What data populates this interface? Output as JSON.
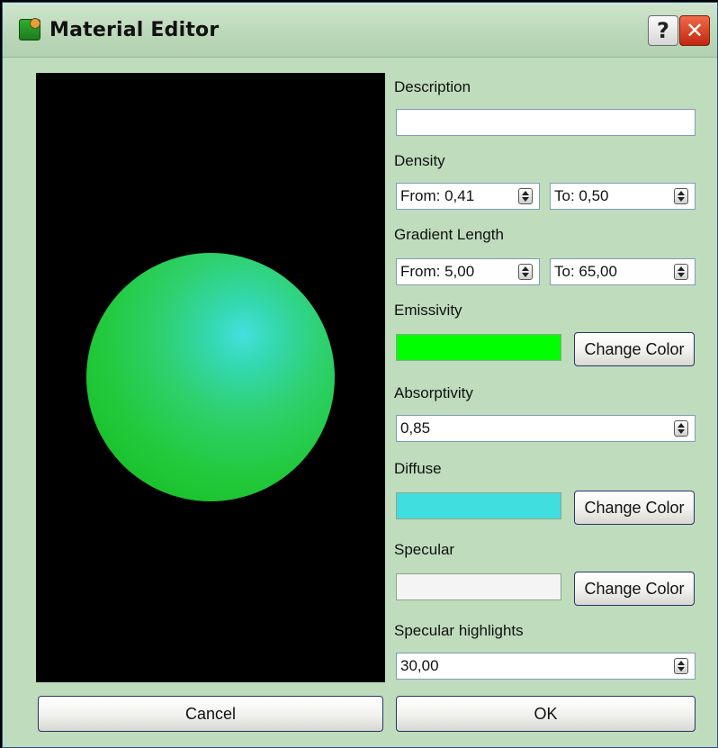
{
  "window": {
    "title": "Material Editor",
    "help_label": "?",
    "close_label": "✕"
  },
  "preview": {
    "diffuse_color": "#40dede",
    "emissive_color": "#00ff00",
    "icon": "material-sphere-preview"
  },
  "description": {
    "label": "Description",
    "value": ""
  },
  "density": {
    "label": "Density",
    "from": "From: 0,41",
    "to": "To: 0,50"
  },
  "gradient_length": {
    "label": "Gradient Length",
    "from": "From: 5,00",
    "to": "To: 65,00"
  },
  "emissivity": {
    "label": "Emissivity",
    "color": "#00ff00",
    "button": "Change Color"
  },
  "absorptivity": {
    "label": "Absorptivity",
    "value": "0,85"
  },
  "diffuse": {
    "label": "Diffuse",
    "color": "#40dede",
    "button": "Change Color"
  },
  "specular": {
    "label": "Specular",
    "color": "#f4f4f4",
    "button": "Change Color"
  },
  "specular_highlights": {
    "label": "Specular highlights",
    "value": "30,00"
  },
  "footer": {
    "cancel": "Cancel",
    "ok": "OK"
  }
}
